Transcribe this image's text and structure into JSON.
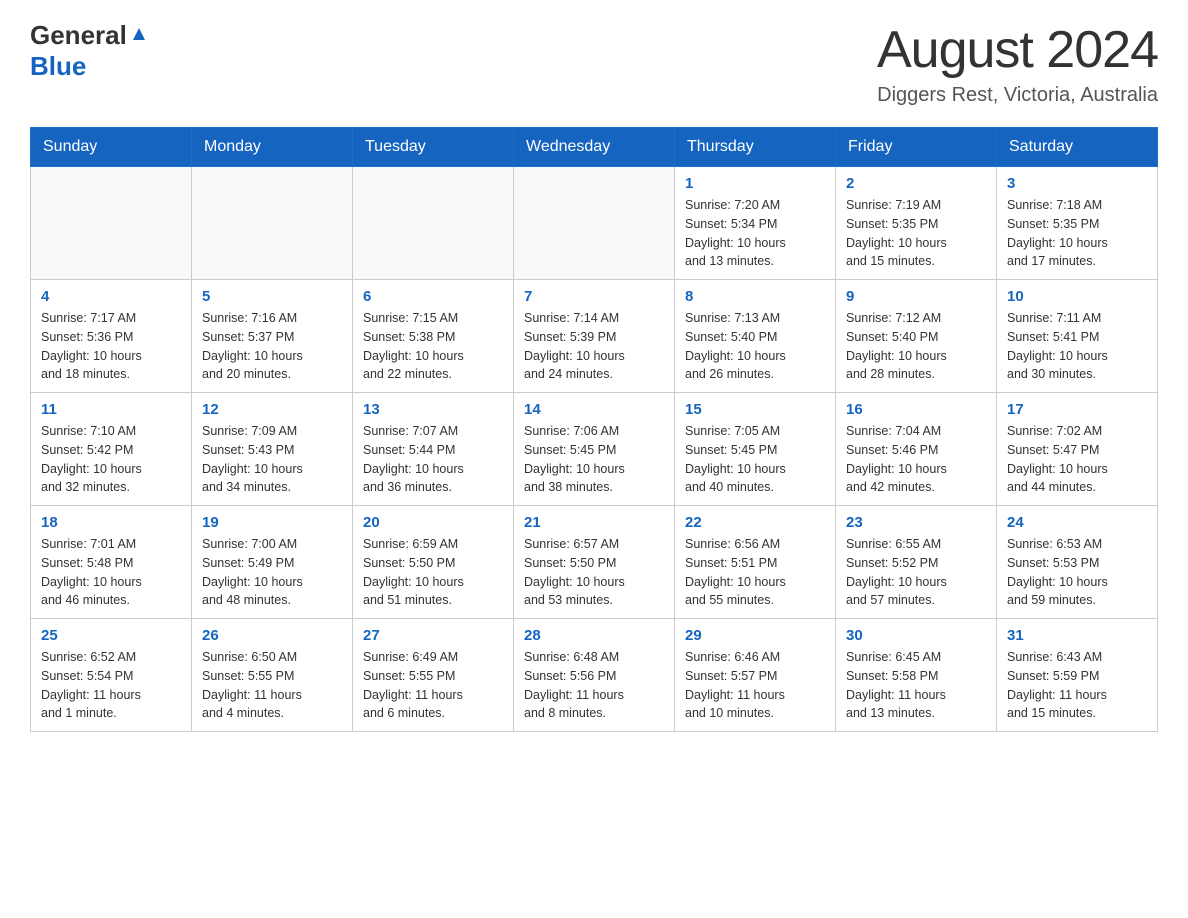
{
  "header": {
    "logo_general": "General",
    "logo_blue": "Blue",
    "month_title": "August 2024",
    "location": "Diggers Rest, Victoria, Australia"
  },
  "days_of_week": [
    "Sunday",
    "Monday",
    "Tuesday",
    "Wednesday",
    "Thursday",
    "Friday",
    "Saturday"
  ],
  "weeks": [
    [
      {
        "day": "",
        "info": ""
      },
      {
        "day": "",
        "info": ""
      },
      {
        "day": "",
        "info": ""
      },
      {
        "day": "",
        "info": ""
      },
      {
        "day": "1",
        "info": "Sunrise: 7:20 AM\nSunset: 5:34 PM\nDaylight: 10 hours\nand 13 minutes."
      },
      {
        "day": "2",
        "info": "Sunrise: 7:19 AM\nSunset: 5:35 PM\nDaylight: 10 hours\nand 15 minutes."
      },
      {
        "day": "3",
        "info": "Sunrise: 7:18 AM\nSunset: 5:35 PM\nDaylight: 10 hours\nand 17 minutes."
      }
    ],
    [
      {
        "day": "4",
        "info": "Sunrise: 7:17 AM\nSunset: 5:36 PM\nDaylight: 10 hours\nand 18 minutes."
      },
      {
        "day": "5",
        "info": "Sunrise: 7:16 AM\nSunset: 5:37 PM\nDaylight: 10 hours\nand 20 minutes."
      },
      {
        "day": "6",
        "info": "Sunrise: 7:15 AM\nSunset: 5:38 PM\nDaylight: 10 hours\nand 22 minutes."
      },
      {
        "day": "7",
        "info": "Sunrise: 7:14 AM\nSunset: 5:39 PM\nDaylight: 10 hours\nand 24 minutes."
      },
      {
        "day": "8",
        "info": "Sunrise: 7:13 AM\nSunset: 5:40 PM\nDaylight: 10 hours\nand 26 minutes."
      },
      {
        "day": "9",
        "info": "Sunrise: 7:12 AM\nSunset: 5:40 PM\nDaylight: 10 hours\nand 28 minutes."
      },
      {
        "day": "10",
        "info": "Sunrise: 7:11 AM\nSunset: 5:41 PM\nDaylight: 10 hours\nand 30 minutes."
      }
    ],
    [
      {
        "day": "11",
        "info": "Sunrise: 7:10 AM\nSunset: 5:42 PM\nDaylight: 10 hours\nand 32 minutes."
      },
      {
        "day": "12",
        "info": "Sunrise: 7:09 AM\nSunset: 5:43 PM\nDaylight: 10 hours\nand 34 minutes."
      },
      {
        "day": "13",
        "info": "Sunrise: 7:07 AM\nSunset: 5:44 PM\nDaylight: 10 hours\nand 36 minutes."
      },
      {
        "day": "14",
        "info": "Sunrise: 7:06 AM\nSunset: 5:45 PM\nDaylight: 10 hours\nand 38 minutes."
      },
      {
        "day": "15",
        "info": "Sunrise: 7:05 AM\nSunset: 5:45 PM\nDaylight: 10 hours\nand 40 minutes."
      },
      {
        "day": "16",
        "info": "Sunrise: 7:04 AM\nSunset: 5:46 PM\nDaylight: 10 hours\nand 42 minutes."
      },
      {
        "day": "17",
        "info": "Sunrise: 7:02 AM\nSunset: 5:47 PM\nDaylight: 10 hours\nand 44 minutes."
      }
    ],
    [
      {
        "day": "18",
        "info": "Sunrise: 7:01 AM\nSunset: 5:48 PM\nDaylight: 10 hours\nand 46 minutes."
      },
      {
        "day": "19",
        "info": "Sunrise: 7:00 AM\nSunset: 5:49 PM\nDaylight: 10 hours\nand 48 minutes."
      },
      {
        "day": "20",
        "info": "Sunrise: 6:59 AM\nSunset: 5:50 PM\nDaylight: 10 hours\nand 51 minutes."
      },
      {
        "day": "21",
        "info": "Sunrise: 6:57 AM\nSunset: 5:50 PM\nDaylight: 10 hours\nand 53 minutes."
      },
      {
        "day": "22",
        "info": "Sunrise: 6:56 AM\nSunset: 5:51 PM\nDaylight: 10 hours\nand 55 minutes."
      },
      {
        "day": "23",
        "info": "Sunrise: 6:55 AM\nSunset: 5:52 PM\nDaylight: 10 hours\nand 57 minutes."
      },
      {
        "day": "24",
        "info": "Sunrise: 6:53 AM\nSunset: 5:53 PM\nDaylight: 10 hours\nand 59 minutes."
      }
    ],
    [
      {
        "day": "25",
        "info": "Sunrise: 6:52 AM\nSunset: 5:54 PM\nDaylight: 11 hours\nand 1 minute."
      },
      {
        "day": "26",
        "info": "Sunrise: 6:50 AM\nSunset: 5:55 PM\nDaylight: 11 hours\nand 4 minutes."
      },
      {
        "day": "27",
        "info": "Sunrise: 6:49 AM\nSunset: 5:55 PM\nDaylight: 11 hours\nand 6 minutes."
      },
      {
        "day": "28",
        "info": "Sunrise: 6:48 AM\nSunset: 5:56 PM\nDaylight: 11 hours\nand 8 minutes."
      },
      {
        "day": "29",
        "info": "Sunrise: 6:46 AM\nSunset: 5:57 PM\nDaylight: 11 hours\nand 10 minutes."
      },
      {
        "day": "30",
        "info": "Sunrise: 6:45 AM\nSunset: 5:58 PM\nDaylight: 11 hours\nand 13 minutes."
      },
      {
        "day": "31",
        "info": "Sunrise: 6:43 AM\nSunset: 5:59 PM\nDaylight: 11 hours\nand 15 minutes."
      }
    ]
  ]
}
